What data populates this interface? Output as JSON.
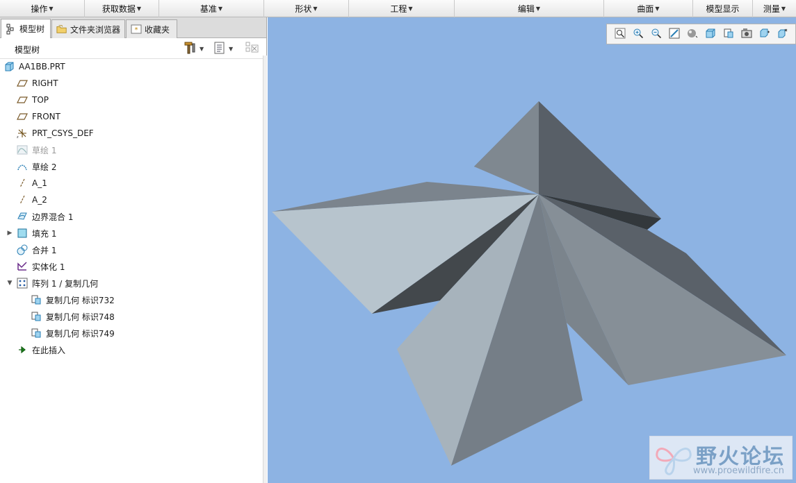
{
  "menubar": {
    "items": [
      {
        "label": "操作"
      },
      {
        "label": "获取数据"
      },
      {
        "label": "基准"
      },
      {
        "label": "形状"
      },
      {
        "label": "工程"
      },
      {
        "label": "编辑"
      },
      {
        "label": "曲面"
      },
      {
        "label": "模型显示"
      },
      {
        "label": "测量"
      }
    ]
  },
  "left_panel": {
    "tabs": [
      {
        "label": "模型树",
        "icon": "model-tree-icon"
      },
      {
        "label": "文件夹浏览器",
        "icon": "folder-browser-icon"
      },
      {
        "label": "收藏夹",
        "icon": "favorites-icon"
      }
    ],
    "header_title": "模型树",
    "tree": [
      {
        "label": "AA1BB.PRT",
        "icon": "part-icon"
      },
      {
        "label": "RIGHT",
        "icon": "datum-plane-icon"
      },
      {
        "label": "TOP",
        "icon": "datum-plane-icon"
      },
      {
        "label": "FRONT",
        "icon": "datum-plane-icon"
      },
      {
        "label": "PRT_CSYS_DEF",
        "icon": "coordinate-system-icon"
      },
      {
        "label": "草绘 1",
        "icon": "sketch-icon"
      },
      {
        "label": "草绘 2",
        "icon": "sketch-icon"
      },
      {
        "label": "A_1",
        "icon": "datum-axis-icon"
      },
      {
        "label": "A_2",
        "icon": "datum-axis-icon"
      },
      {
        "label": "边界混合 1",
        "icon": "boundary-blend-icon"
      },
      {
        "label": "填充 1",
        "icon": "fill-icon"
      },
      {
        "label": "合并 1",
        "icon": "merge-icon"
      },
      {
        "label": "实体化 1",
        "icon": "solidify-icon"
      },
      {
        "label": "阵列 1 / 复制几何",
        "icon": "pattern-icon"
      },
      {
        "label": "复制几何 标识732",
        "icon": "copy-geometry-icon"
      },
      {
        "label": "复制几何 标识748",
        "icon": "copy-geometry-icon"
      },
      {
        "label": "复制几何 标识749",
        "icon": "copy-geometry-icon"
      },
      {
        "label": "在此插入",
        "icon": "insert-here-arrow-icon"
      }
    ]
  },
  "view_toolbar": {
    "buttons": [
      "refit-icon",
      "zoom-in-icon",
      "zoom-out-icon",
      "repaint-icon",
      "display-style-icon",
      "saved-views-icon",
      "view-manager-icon",
      "camera-icon",
      "datum-display-icon",
      "spin-center-icon"
    ]
  },
  "watermark": {
    "title": "野火论坛",
    "url": "www.proewildfire.cn"
  },
  "colors": {
    "viewport_bg": "#8db3e3",
    "accent": "#2a8fd0"
  }
}
